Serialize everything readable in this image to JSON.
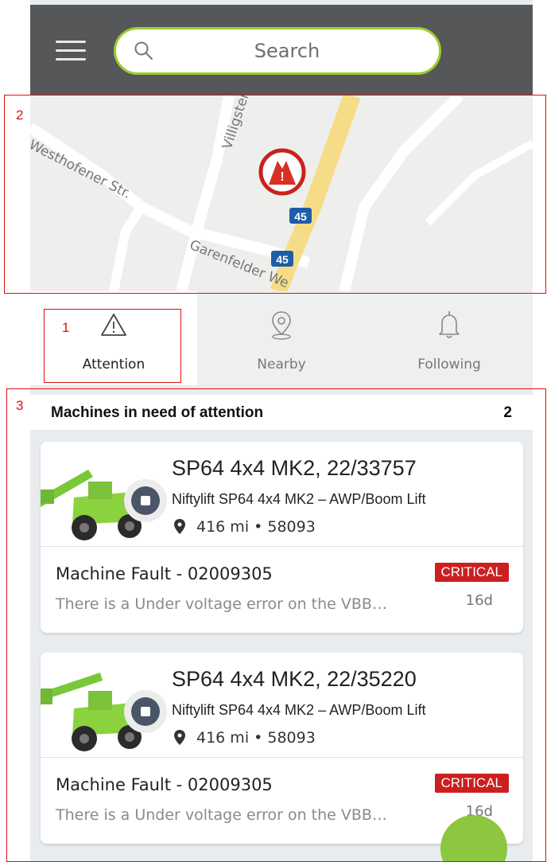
{
  "search": {
    "placeholder": "Search"
  },
  "map": {
    "street_labels": [
      "Westhofener Str.",
      "Villigster",
      "Garenfelder We"
    ],
    "highway_shield": "45",
    "alert_marker": "!"
  },
  "tabs": [
    {
      "label": "Attention",
      "icon": "warning-triangle-icon",
      "active": true
    },
    {
      "label": "Nearby",
      "icon": "location-pin-icon",
      "active": false
    },
    {
      "label": "Following",
      "icon": "bell-icon",
      "active": false
    }
  ],
  "list": {
    "title": "Machines in need of attention",
    "count": "2",
    "machines": [
      {
        "title": "SP64 4x4 MK2, 22/33757",
        "subtitle": "Niftylift SP64 4x4 MK2 – AWP/Boom Lift",
        "location": "416 mi • 58093",
        "fault": "Machine Fault - 02009305",
        "description": "There is a Under voltage error on the VBB…",
        "severity": "CRITICAL",
        "age": "16d"
      },
      {
        "title": "SP64 4x4 MK2, 22/35220",
        "subtitle": "Niftylift SP64 4x4 MK2 – AWP/Boom Lift",
        "location": "416 mi • 58093",
        "fault": "Machine Fault - 02009305",
        "description": "There is a Under voltage error on the VBB…",
        "severity": "CRITICAL",
        "age": "16d"
      }
    ]
  },
  "annotations": [
    "1",
    "2",
    "3"
  ],
  "colors": {
    "header": "#555758",
    "accent_green": "#9ccc2f",
    "critical_red": "#cc1f1f",
    "annotation_red": "#e01010"
  }
}
